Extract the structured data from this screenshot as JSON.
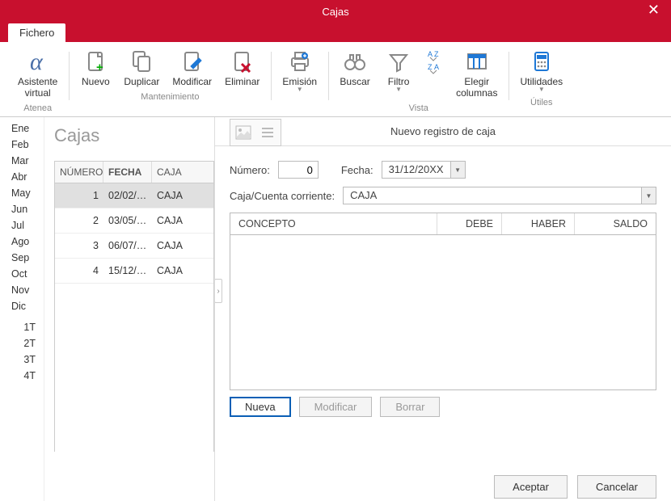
{
  "window": {
    "title": "Cajas"
  },
  "ribbon": {
    "tab": "Fichero",
    "group_atenea": {
      "label": "Atenea",
      "btn_virtual": "Asistente\nvirtual"
    },
    "group_mant": {
      "label": "Mantenimiento",
      "nuevo": "Nuevo",
      "duplicar": "Duplicar",
      "modificar": "Modificar",
      "eliminar": "Eliminar"
    },
    "group_emision": {
      "label": "",
      "emision": "Emisión"
    },
    "group_vista": {
      "label": "Vista",
      "buscar": "Buscar",
      "filtro": "Filtro",
      "elegir": "Elegir\ncolumnas"
    },
    "group_utiles": {
      "label": "Útiles",
      "utilidades": "Utilidades"
    }
  },
  "periods": [
    {
      "v": "Ene",
      "a": "l"
    },
    {
      "v": "Feb",
      "a": "l"
    },
    {
      "v": "Mar",
      "a": "l"
    },
    {
      "v": "Abr",
      "a": "l"
    },
    {
      "v": "May",
      "a": "l"
    },
    {
      "v": "Jun",
      "a": "l"
    },
    {
      "v": "Jul",
      "a": "l"
    },
    {
      "v": "Ago",
      "a": "l"
    },
    {
      "v": "Sep",
      "a": "l"
    },
    {
      "v": "Oct",
      "a": "l"
    },
    {
      "v": "Nov",
      "a": "l"
    },
    {
      "v": "Dic",
      "a": "l"
    },
    {
      "v": " ",
      "a": "l"
    },
    {
      "v": "1T",
      "a": "r"
    },
    {
      "v": "2T",
      "a": "r"
    },
    {
      "v": "3T",
      "a": "r"
    },
    {
      "v": "4T",
      "a": "r"
    }
  ],
  "leftpanel": {
    "title": "Cajas",
    "cols": {
      "numero": "NÚMERO",
      "fecha": "FECHA",
      "caja": "CAJA"
    },
    "rows": [
      {
        "numero": "1",
        "fecha": "02/02/2...",
        "caja": "CAJA",
        "selected": true
      },
      {
        "numero": "2",
        "fecha": "03/05/2...",
        "caja": "CAJA"
      },
      {
        "numero": "3",
        "fecha": "06/07/2...",
        "caja": "CAJA"
      },
      {
        "numero": "4",
        "fecha": "15/12/2...",
        "caja": "CAJA"
      }
    ]
  },
  "rightpanel": {
    "title": "Nuevo registro de caja",
    "form": {
      "numero_label": "Número:",
      "numero_value": "0",
      "fecha_label": "Fecha:",
      "fecha_value": "31/12/20XX",
      "caja_label": "Caja/Cuenta corriente:",
      "caja_value": "CAJA"
    },
    "grid": {
      "concepto": "CONCEPTO",
      "debe": "DEBE",
      "haber": "HABER",
      "saldo": "SALDO"
    },
    "buttons": {
      "nueva": "Nueva",
      "modificar": "Modificar",
      "borrar": "Borrar",
      "aceptar": "Aceptar",
      "cancelar": "Cancelar"
    }
  }
}
